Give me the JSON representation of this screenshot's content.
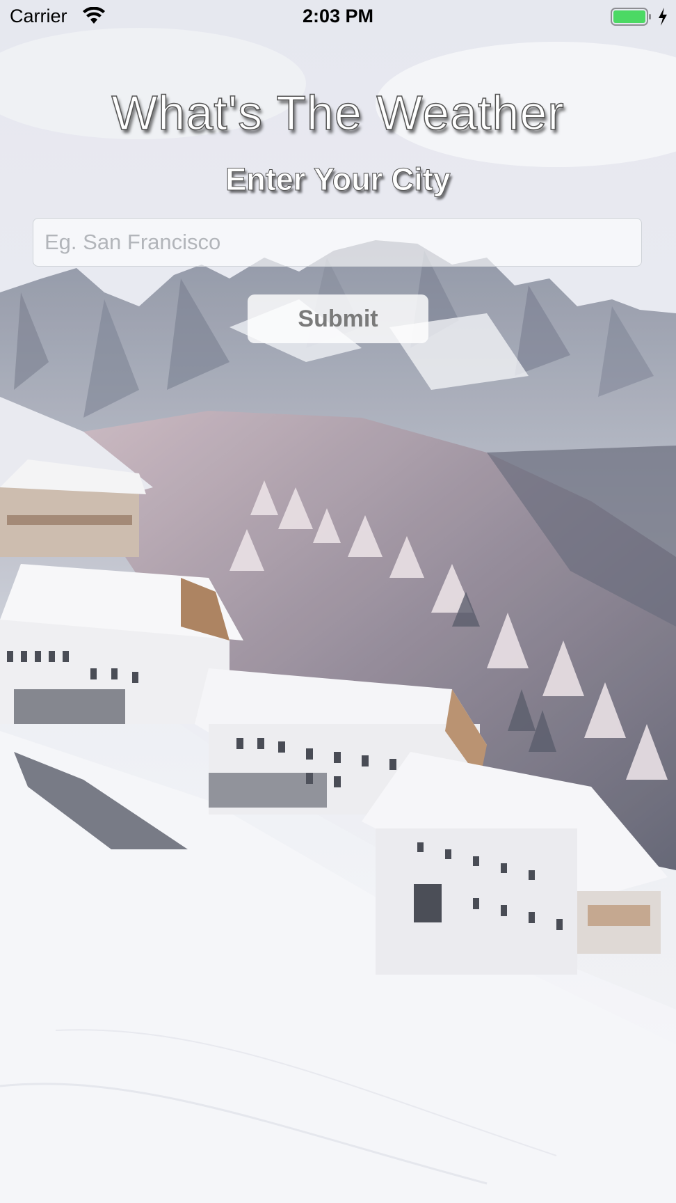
{
  "status_bar": {
    "carrier": "Carrier",
    "time": "2:03 PM",
    "icons": [
      "wifi-icon",
      "battery-icon",
      "charging-bolt-icon"
    ],
    "battery_color": "#4cd964"
  },
  "main": {
    "title": "What's The Weather",
    "subtitle": "Enter Your City",
    "city_input": {
      "value": "",
      "placeholder": "Eg. San Francisco"
    },
    "submit_label": "Submit"
  },
  "background": {
    "description_icon": "snowy-mountain-village-image"
  }
}
